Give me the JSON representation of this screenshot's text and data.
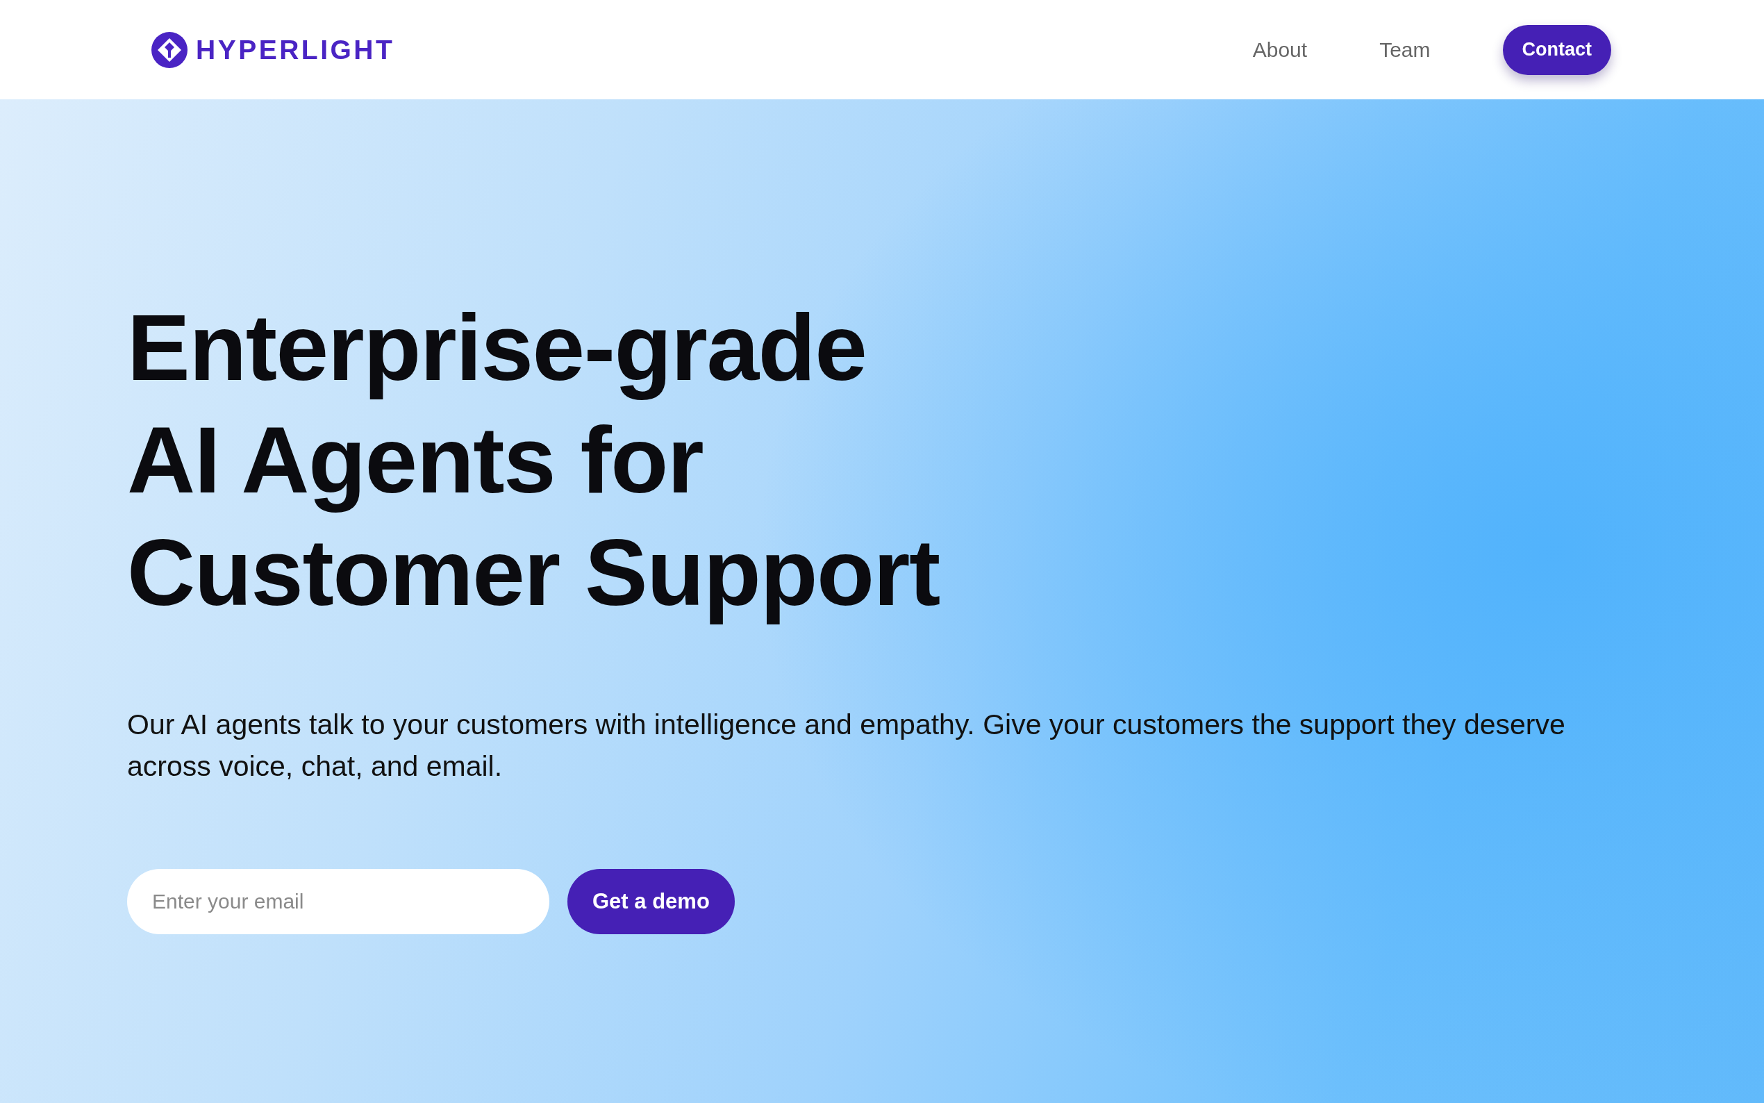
{
  "header": {
    "logo": {
      "text": "HYPERLIGHT"
    },
    "nav": [
      {
        "label": "About"
      },
      {
        "label": "Team"
      }
    ],
    "cta": {
      "label": "Contact"
    }
  },
  "hero": {
    "heading_lines": [
      "Enterprise-grade",
      "AI Agents for",
      "Customer Support"
    ],
    "description": "Our AI agents talk to your customers with intelligence and empathy. Give your customers the support they deserve across voice, chat, and email.",
    "email_field": {
      "placeholder": "Enter your email"
    },
    "submit": {
      "label": "Get a demo"
    }
  }
}
